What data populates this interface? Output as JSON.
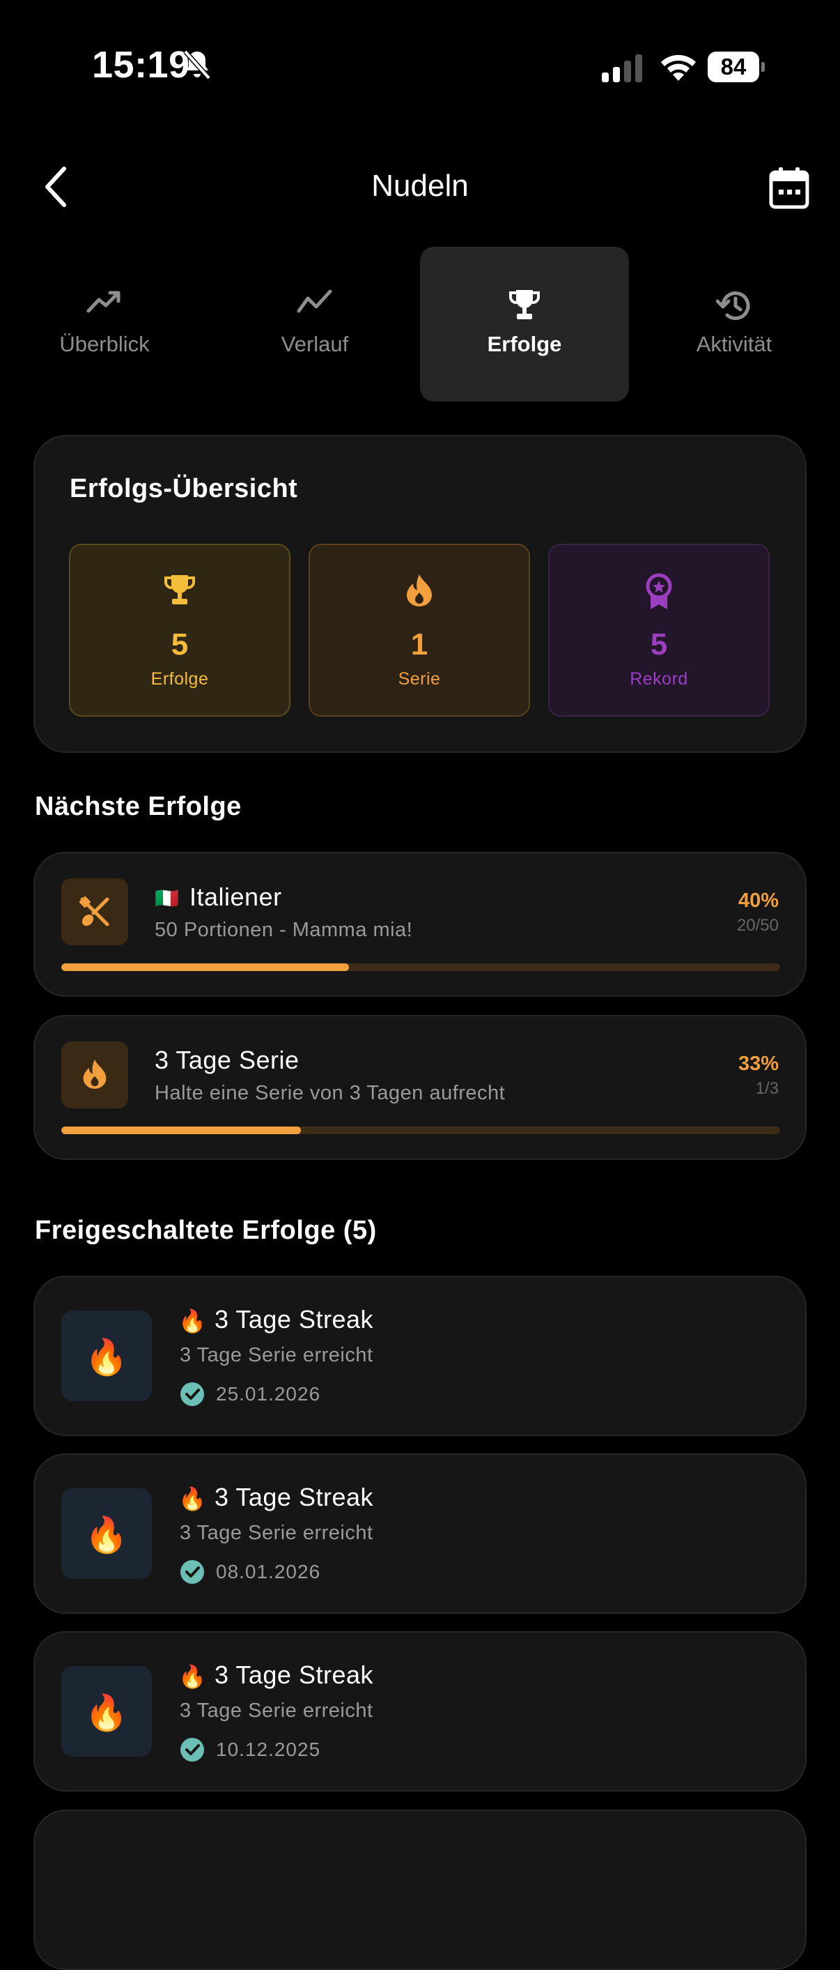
{
  "status_bar": {
    "time": "15:19",
    "battery": "84"
  },
  "header": {
    "title": "Nudeln"
  },
  "tabs": [
    {
      "label": "Überblick",
      "icon": "trending-up-icon",
      "active": false
    },
    {
      "label": "Verlauf",
      "icon": "chart-line-icon",
      "active": false
    },
    {
      "label": "Erfolge",
      "icon": "trophy-icon",
      "active": true
    },
    {
      "label": "Aktivität",
      "icon": "history-icon",
      "active": false
    }
  ],
  "overview": {
    "title": "Erfolgs-Übersicht",
    "stats": [
      {
        "value": "5",
        "label": "Erfolge",
        "icon": "trophy-icon",
        "color": "#f5bd3a"
      },
      {
        "value": "1",
        "label": "Serie",
        "icon": "flame-icon",
        "color": "#f2a03d"
      },
      {
        "value": "5",
        "label": "Rekord",
        "icon": "award-icon",
        "color": "#9b3fc0"
      }
    ]
  },
  "next": {
    "title": "Nächste Erfolge",
    "items": [
      {
        "flag": "🇮🇹",
        "title": "Italiener",
        "subtitle": "50 Portionen - Mamma mia!",
        "percent": "40%",
        "count": "20/50",
        "progress": 0.4,
        "icon": "cutlery-icon"
      },
      {
        "title": "3 Tage Serie",
        "subtitle": "Halte eine Serie von 3 Tagen aufrecht",
        "percent": "33%",
        "count": "1/3",
        "progress": 0.333,
        "icon": "flame-icon"
      }
    ]
  },
  "unlocked": {
    "title": "Freigeschaltete Erfolge (5)",
    "items": [
      {
        "emoji": "🔥",
        "title": "3 Tage Streak",
        "subtitle": "3 Tage Serie erreicht",
        "date": "25.01.2026"
      },
      {
        "emoji": "🔥",
        "title": "3 Tage Streak",
        "subtitle": "3 Tage Serie erreicht",
        "date": "08.01.2026"
      },
      {
        "emoji": "🔥",
        "title": "3 Tage Streak",
        "subtitle": "3 Tage Serie erreicht",
        "date": "10.12.2025"
      }
    ]
  },
  "colors": {
    "accent_orange": "#f2a03d",
    "gold": "#f5bd3a",
    "purple": "#9b3fc0",
    "check_teal": "#6cbfb5"
  }
}
